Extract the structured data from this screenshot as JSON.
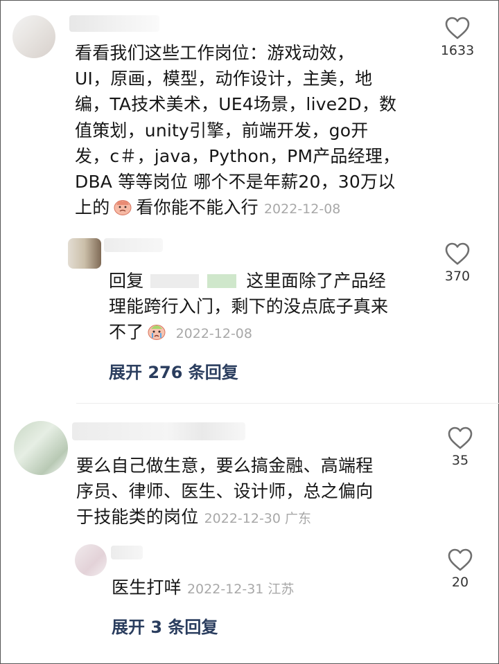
{
  "comments": [
    {
      "text_lines": [
        "看看我们这些工作岗位：游戏动效，",
        "UI，原画，模型，动作设计，主美，地",
        "编，TA技术美术，UE4场景，live2D，数",
        "值策划，unity引擎，前端开发，go开",
        "发，c＃，java，Python，PM产品经理，",
        "DBA 等等岗位  哪个不是年薪20，30万以"
      ],
      "last_line_before_emoji": "上的",
      "last_line_after_emoji": "看你能不能入行",
      "time": "2022-12-08",
      "likes": "1633",
      "reply": {
        "prefix": "回复",
        "line1": "这里面除了产品经",
        "line2": "理能跨行入门，剩下的没点底子真来",
        "line3": "不了",
        "time": "2022-12-08",
        "likes": "370"
      },
      "expand_label": "展开 276 条回复"
    },
    {
      "text_lines": [
        "要么自己做生意，要么搞金融、高端程",
        "序员、律师、医生、设计师，总之偏向"
      ],
      "last_line": "于技能类的岗位",
      "time": "2022-12-30 广东",
      "likes": "35",
      "reply": {
        "text": "医生打咩",
        "time": "2022-12-31 江苏",
        "likes": "20"
      },
      "expand_label": "展开 3 条回复"
    }
  ],
  "icons": {
    "like": "heart-outline-icon",
    "emoji_1": "sad-face-emoji-icon",
    "emoji_2": "crying-face-emoji-icon"
  }
}
